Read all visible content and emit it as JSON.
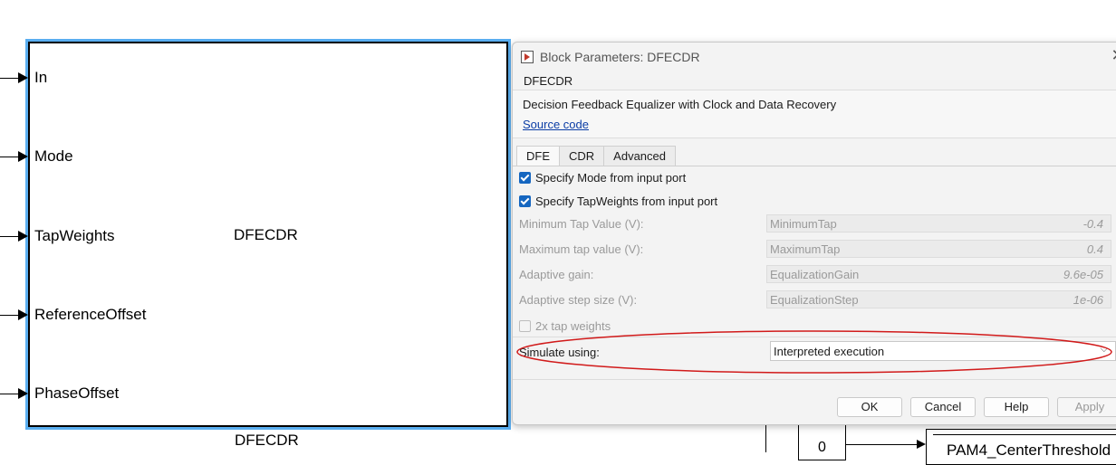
{
  "canvas": {
    "block": {
      "center_label": "DFECDR",
      "caption": "DFECDR",
      "ports": [
        "In",
        "Mode",
        "TapWeights",
        "ReferenceOffset",
        "PhaseOffset"
      ]
    },
    "constant_value": "0",
    "pam_block_label": "PAM4_CenterThreshold"
  },
  "dialog": {
    "title": "Block Parameters: DFECDR",
    "close_glyph": "✕",
    "block_name": "DFECDR",
    "description": "Decision Feedback Equalizer with Clock and Data Recovery",
    "source_link": "Source code",
    "tabs": [
      {
        "label": "DFE",
        "active": true
      },
      {
        "label": "CDR",
        "active": false
      },
      {
        "label": "Advanced",
        "active": false
      }
    ],
    "checkboxes": [
      {
        "label": "Specify Mode from input port",
        "checked": true,
        "enabled": true
      },
      {
        "label": "Specify TapWeights from input port",
        "checked": true,
        "enabled": true
      },
      {
        "label": "2x tap weights",
        "checked": false,
        "enabled": false
      }
    ],
    "params": [
      {
        "label": "Minimum Tap Value (V):",
        "expr": "MinimumTap",
        "value": "-0.4"
      },
      {
        "label": "Maximum tap value (V):",
        "expr": "MaximumTap",
        "value": "0.4"
      },
      {
        "label": "Adaptive gain:",
        "expr": "EqualizationGain",
        "value": "9.6e-05"
      },
      {
        "label": "Adaptive step size (V):",
        "expr": "EqualizationStep",
        "value": "1e-06"
      }
    ],
    "simulate": {
      "label": "Simulate using:",
      "value": "Interpreted execution"
    },
    "buttons": {
      "ok": "OK",
      "cancel": "Cancel",
      "help": "Help",
      "apply": "Apply"
    }
  },
  "colors": {
    "selection_outline": "#5aaef0",
    "checkbox_checked": "#1566c0",
    "highlight_ellipse": "#d11a1a",
    "link": "#0a3ca5"
  }
}
